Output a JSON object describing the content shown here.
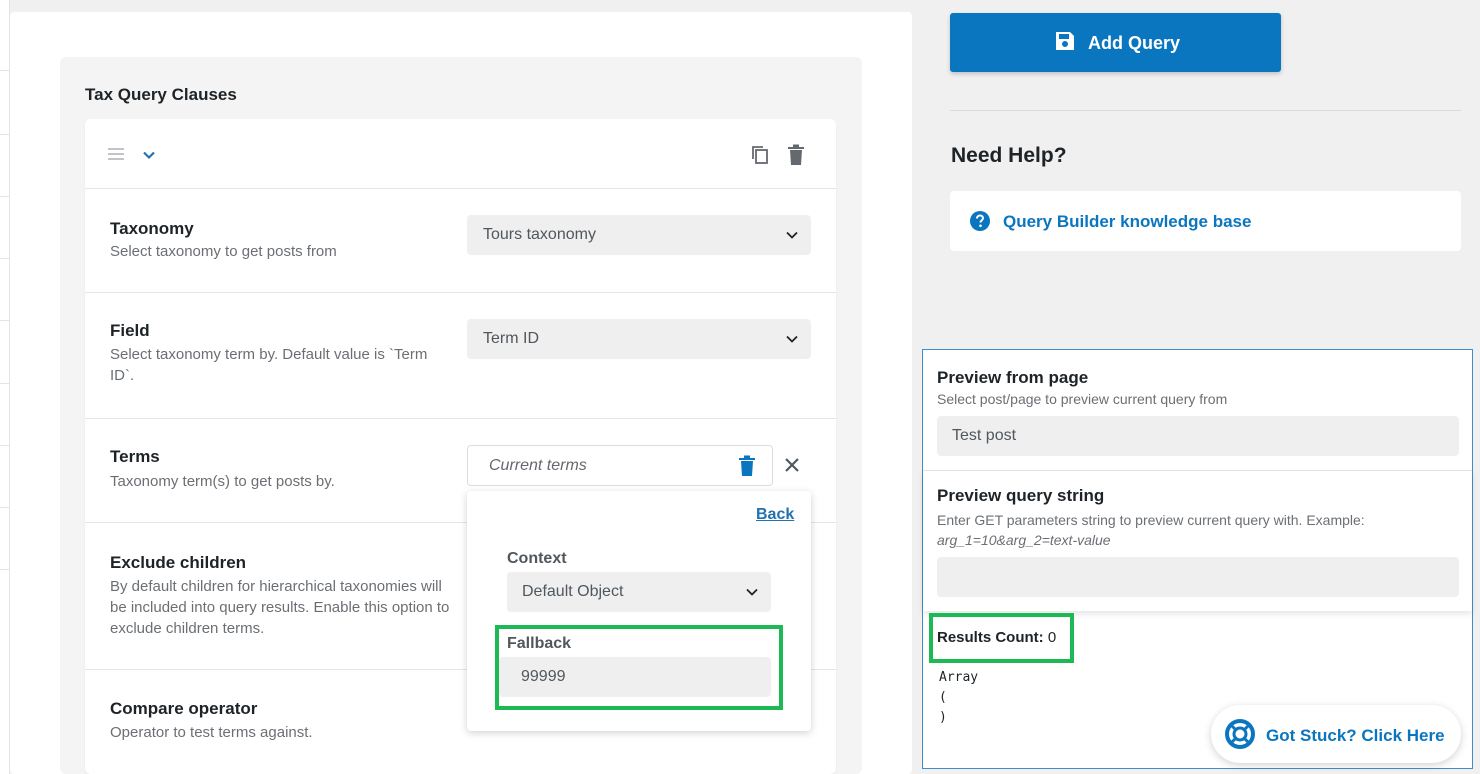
{
  "sidebar_actions": {
    "add_query_label": "Add Query",
    "help_title": "Need Help?",
    "kb_link_label": "Query Builder knowledge base"
  },
  "tax_query": {
    "title": "Tax Query Clauses",
    "fields": {
      "taxonomy": {
        "title": "Taxonomy",
        "description": "Select taxonomy to get posts from",
        "value": "Tours taxonomy"
      },
      "field": {
        "title": "Field",
        "description": "Select taxonomy term by. Default value is `Term ID`.",
        "value": "Term ID"
      },
      "terms": {
        "title": "Terms",
        "description": "Taxonomy term(s) to get posts by.",
        "placeholder": "Current terms"
      },
      "exclude_children": {
        "title": "Exclude children",
        "description": "By default children for hierarchical taxonomies will be included into query results. Enable this option to exclude children terms."
      },
      "compare_operator": {
        "title": "Compare operator",
        "description": "Operator to test terms against."
      }
    }
  },
  "popover": {
    "back_label": "Back",
    "context_label": "Context",
    "context_value": "Default Object",
    "fallback_label": "Fallback",
    "fallback_value": "99999"
  },
  "preview": {
    "from_page_title": "Preview from page",
    "from_page_desc": "Select post/page to preview current query from",
    "from_page_value": "Test post",
    "query_string_title": "Preview query string",
    "query_string_desc": "Enter GET parameters string to preview current query with. Example:",
    "query_string_example": "arg_1=10&arg_2=text-value",
    "query_string_value": "",
    "results_label": "Results Count:",
    "results_value": "0",
    "array_output": "Array\n(\n)"
  },
  "support": {
    "stuck_label": "Got Stuck? Click Here"
  },
  "colors": {
    "accent": "#0a76c0",
    "highlight": "#1db954",
    "panel_border": "#3b8ed0"
  },
  "icons": [
    "save-icon",
    "question-circle-icon",
    "drag-handle-icon",
    "chevron-down-icon",
    "copy-icon",
    "trash-icon",
    "close-icon",
    "lifebuoy-icon"
  ]
}
